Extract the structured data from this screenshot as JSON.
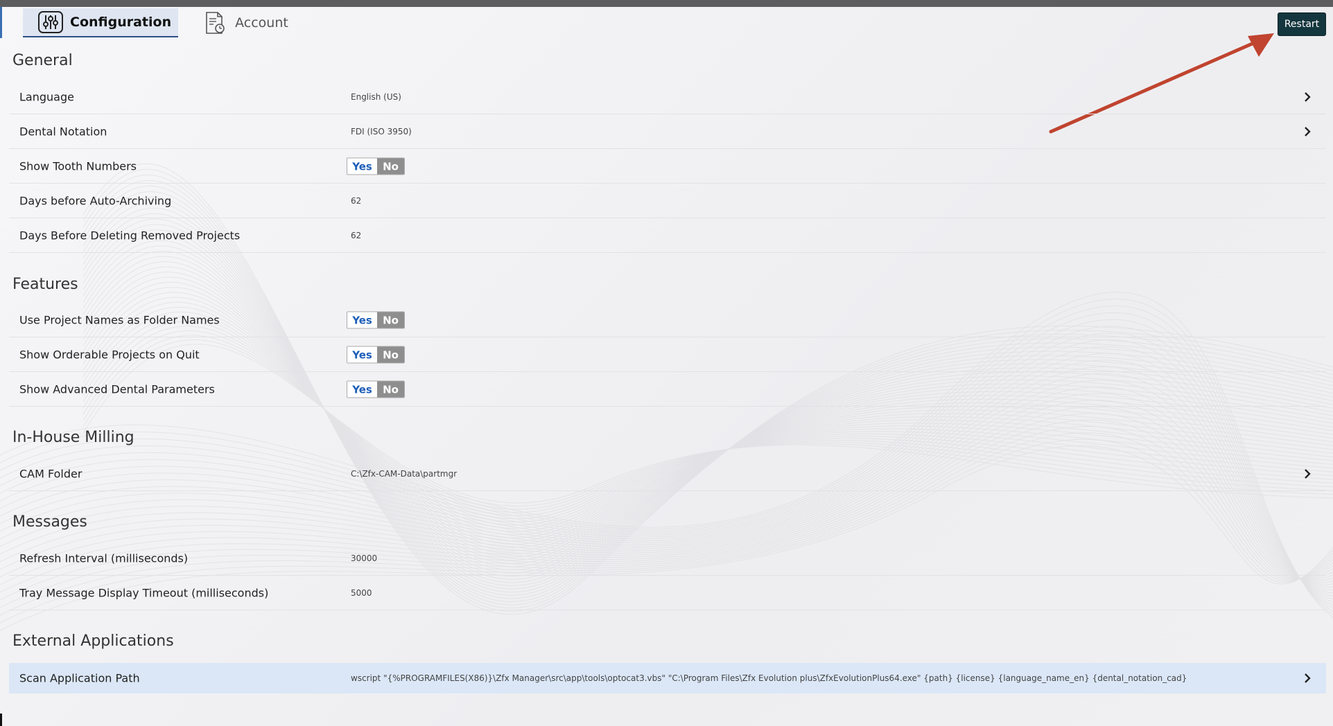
{
  "tabs": [
    {
      "label": "Configuration",
      "active": true,
      "icon": "sliders-icon"
    },
    {
      "label": "Account",
      "active": false,
      "icon": "account-document-icon"
    }
  ],
  "restart_label": "Restart",
  "toggle_yes": "Yes",
  "toggle_no": "No",
  "sections": {
    "general": {
      "title": "General",
      "language": {
        "label": "Language",
        "value": "English (US)"
      },
      "dental_notation": {
        "label": "Dental Notation",
        "value": "FDI (ISO 3950)"
      },
      "show_tooth_numbers": {
        "label": "Show Tooth Numbers",
        "value": "Yes"
      },
      "days_auto_archiving": {
        "label": "Days before Auto-Archiving",
        "value": "62"
      },
      "days_deleting": {
        "label": "Days Before Deleting Removed Projects",
        "value": "62"
      }
    },
    "features": {
      "title": "Features",
      "project_names": {
        "label": "Use Project Names as Folder Names",
        "value": "Yes"
      },
      "orderable_projects": {
        "label": "Show Orderable Projects on Quit",
        "value": "Yes"
      },
      "advanced_dental": {
        "label": "Show Advanced Dental Parameters",
        "value": "Yes"
      }
    },
    "milling": {
      "title": "In-House Milling",
      "cam_folder": {
        "label": "CAM Folder",
        "value": "C:\\Zfx-CAM-Data\\partmgr"
      }
    },
    "messages": {
      "title": "Messages",
      "refresh_interval": {
        "label": "Refresh Interval (milliseconds)",
        "value": "30000"
      },
      "tray_timeout": {
        "label": "Tray Message Display Timeout (milliseconds)",
        "value": "5000"
      }
    },
    "external": {
      "title": "External Applications",
      "scan_path": {
        "label": "Scan Application Path",
        "value": "wscript \"{%PROGRAMFILES(X86)}\\Zfx Manager\\src\\app\\tools\\optocat3.vbs\" \"C:\\Program Files\\Zfx Evolution plus\\ZfxEvolutionPlus64.exe\" {path} {license} {language_name_en} {dental_notation_cad}"
      }
    }
  },
  "colors": {
    "restart_bg": "#14363e",
    "active_tab_bg": "#dfe6f2",
    "selected_row_bg": "#dbe7f7",
    "toggle_yes_text": "#1f5fb8",
    "toggle_no_bg": "#8e8e8e",
    "annotation_arrow": "#c0442f"
  }
}
